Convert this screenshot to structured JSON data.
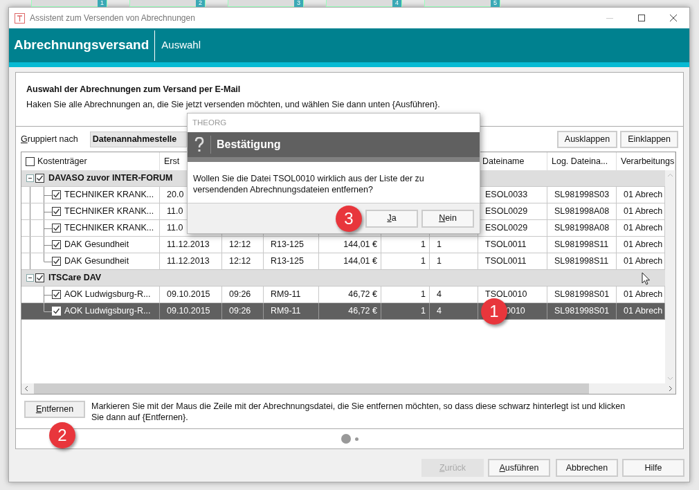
{
  "background_tabs": [
    {
      "number": "1"
    },
    {
      "number": "2"
    },
    {
      "number": "3"
    },
    {
      "number": "4"
    },
    {
      "number": "5"
    }
  ],
  "window": {
    "title": "Assistent zum Versenden von Abrechnungen"
  },
  "header": {
    "title": "Abrechnungsversand",
    "step": "Auswahl"
  },
  "intro": {
    "heading": "Auswahl der Abrechnungen zum Versand per E-Mail",
    "text": "Haken Sie alle Abrechnungen an, die Sie jetzt versenden möchten, und wählen Sie dann unten {Ausführen}."
  },
  "grouping": {
    "label": "Gruppiert nach",
    "mnemonic": true,
    "value": "Datenannahmestelle"
  },
  "tree_buttons": [
    {
      "label": "Ausklappen"
    },
    {
      "label": "Einklappen"
    }
  ],
  "table": {
    "select_all_checked": false,
    "columns": [
      {
        "label": "Kostenträger"
      },
      {
        "label": "Erst"
      },
      {},
      {},
      {},
      {},
      {},
      {
        "label": "Dateiname"
      },
      {
        "label": "Log. Dateina..."
      },
      {
        "label": "Verarbeitungs"
      }
    ],
    "groups": [
      {
        "name": "DAVASO zuvor INTER-FORUM",
        "checked": true,
        "expanded": true,
        "rows": [
          {
            "checked": true,
            "selected": false,
            "cells": [
              "TECHNIKER KRANK...",
              "20.0",
              null,
              null,
              null,
              null,
              null,
              "ESOL0033",
              "SL981998S03",
              "01 Abrech"
            ]
          },
          {
            "checked": true,
            "selected": false,
            "cells": [
              "TECHNIKER KRANK...",
              "11.0",
              null,
              null,
              null,
              null,
              null,
              "ESOL0029",
              "SL981998A08",
              "01 Abrech"
            ]
          },
          {
            "checked": true,
            "selected": false,
            "cells": [
              "TECHNIKER KRANK...",
              "11.0",
              null,
              null,
              null,
              null,
              null,
              "ESOL0029",
              "SL981998A08",
              "01 Abrech"
            ]
          },
          {
            "checked": true,
            "selected": false,
            "cells": [
              "DAK Gesundheit",
              "11.12.2013",
              "12:12",
              "R13-125",
              "144,01 €",
              "1",
              "1",
              "TSOL0011",
              "SL981998S11",
              "01 Abrech"
            ]
          },
          {
            "checked": true,
            "selected": false,
            "cells": [
              "DAK Gesundheit",
              "11.12.2013",
              "12:12",
              "R13-125",
              "144,01 €",
              "1",
              "1",
              "TSOL0011",
              "SL981998S11",
              "01 Abrech"
            ]
          }
        ]
      },
      {
        "name": "ITSCare DAV",
        "checked": true,
        "expanded": true,
        "rows": [
          {
            "checked": true,
            "selected": false,
            "cells": [
              "AOK Ludwigsburg-R...",
              "09.10.2015",
              "09:26",
              "RM9-11",
              "46,72 €",
              "1",
              "4",
              "TSOL0010",
              "SL981998S01",
              "01 Abrech"
            ]
          },
          {
            "checked": true,
            "selected": true,
            "badge": "1",
            "cells": [
              "AOK Ludwigsburg-R...",
              "09.10.2015",
              "09:26",
              "RM9-11",
              "46,72 €",
              "1",
              "4",
              "0010",
              "SL981998S01",
              "01 Abrech"
            ]
          }
        ]
      }
    ]
  },
  "remove": {
    "button": {
      "label": "Entfernen",
      "mnemonic": true,
      "badge": "2"
    },
    "hint": "Markieren Sie mit der Maus die Zeile mit der Abrechnungsdatei, die Sie entfernen möchten, so dass diese schwarz hinterlegt ist und klicken Sie dann auf {Entfernen}."
  },
  "page_indicator": [
    {
      "selected": true
    },
    {
      "selected": false
    }
  ],
  "footer_buttons": [
    {
      "label": "Zurück",
      "mnemonic": true,
      "disabled": true
    },
    {
      "label": "Ausführen",
      "mnemonic": true,
      "disabled": false
    },
    {
      "label": "Abbrechen",
      "mnemonic": false,
      "disabled": false
    },
    {
      "label": "Hilfe",
      "mnemonic": false,
      "disabled": false
    }
  ],
  "dialog": {
    "app": "THEORG",
    "title": "Bestätigung",
    "message": "Wollen Sie die Datei TSOL0010 wirklich aus der Liste der zu versendenden Abrechnungsdateien entfernen?",
    "buttons": [
      {
        "label": "Ja",
        "mnemonic": true,
        "badge": "3"
      },
      {
        "label": "Nein",
        "mnemonic": true
      }
    ]
  }
}
